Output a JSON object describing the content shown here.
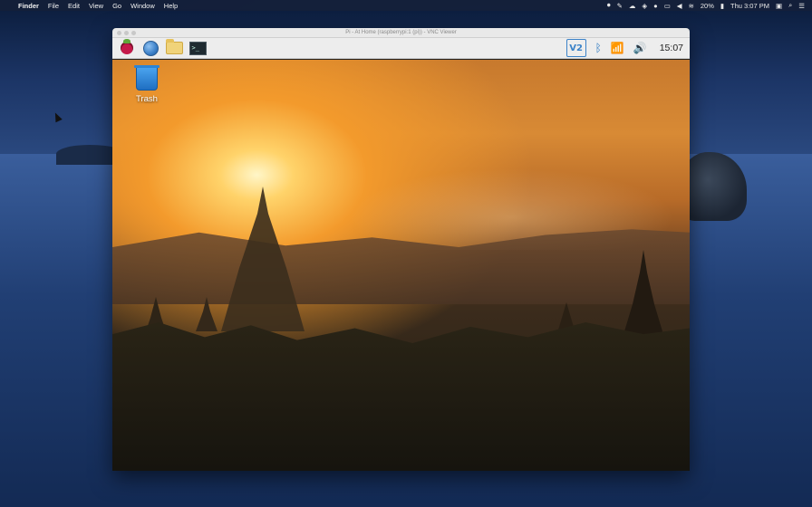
{
  "menubar": {
    "app_name": "Finder",
    "items": [
      "File",
      "Edit",
      "View",
      "Go",
      "Window",
      "Help"
    ],
    "battery": "20%",
    "clock": "Thu 3:07 PM"
  },
  "vnc_window": {
    "title": "Pi - At Home (raspberrypi:1 (pi)) - VNC Viewer"
  },
  "panel": {
    "clock": "15:07",
    "vnc_label": "V2",
    "terminal_glyph": ">_"
  },
  "remote_desktop": {
    "trash_label": "Trash"
  },
  "colors": {
    "accent": "#3b82c8",
    "menubar_bg": "#141e37"
  }
}
